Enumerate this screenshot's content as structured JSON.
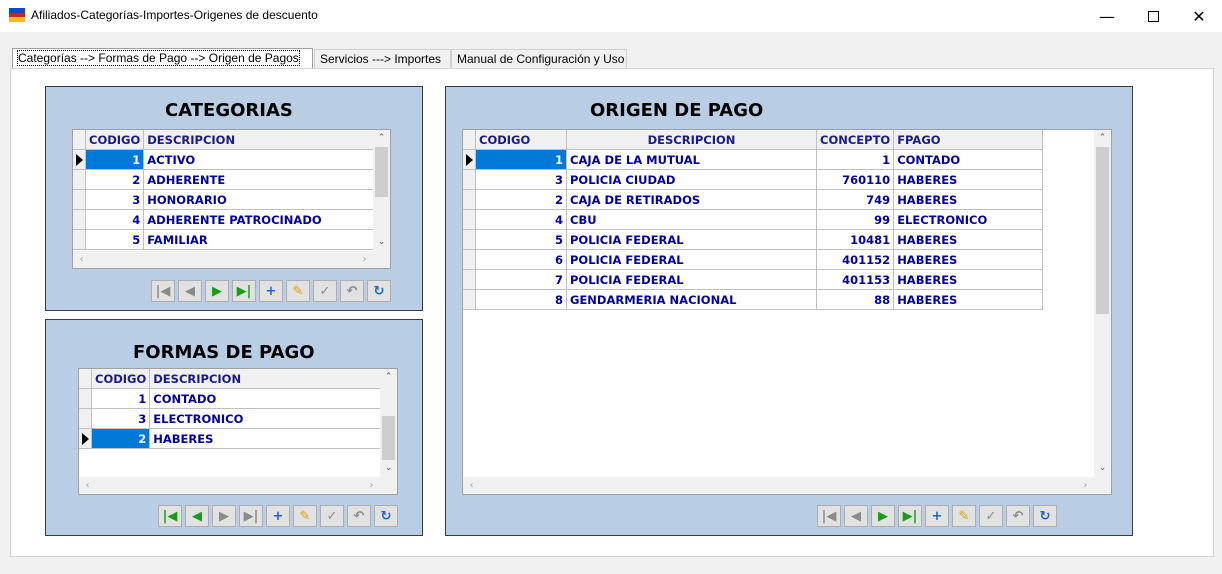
{
  "window": {
    "title": "Afiliados-Categorías-Importes-Origenes de descuento",
    "flag_colors": [
      "#2040c0",
      "#d02020",
      "#f0c000"
    ]
  },
  "tabs": [
    {
      "label": "Categorías  --> Formas de Pago   --> Origen de Pagos",
      "active": true
    },
    {
      "label": "Servicios  ---> Importes",
      "active": false
    },
    {
      "label": "Manual de Configuración y Uso",
      "active": false
    }
  ],
  "categorias": {
    "title": "CATEGORIAS",
    "headers": [
      "CODIGO",
      "DESCRIPCION"
    ],
    "rows": [
      {
        "codigo": "1",
        "descripcion": "ACTIVO"
      },
      {
        "codigo": "2",
        "descripcion": "ADHERENTE"
      },
      {
        "codigo": "3",
        "descripcion": "HONORARIO"
      },
      {
        "codigo": "4",
        "descripcion": "ADHERENTE PATROCINADO"
      },
      {
        "codigo": "5",
        "descripcion": "FAMILIAR"
      }
    ]
  },
  "formas_pago": {
    "title": "FORMAS DE PAGO",
    "headers": [
      "CODIGO",
      "DESCRIPCION"
    ],
    "rows": [
      {
        "codigo": "1",
        "descripcion": "CONTADO"
      },
      {
        "codigo": "3",
        "descripcion": "ELECTRONICO"
      },
      {
        "codigo": "2",
        "descripcion": "HABERES"
      }
    ]
  },
  "origen_pago": {
    "title": "ORIGEN DE PAGO",
    "headers": [
      "CODIGO",
      "DESCRIPCION",
      "CONCEPTO",
      "FPAGO"
    ],
    "rows": [
      {
        "codigo": "1",
        "descripcion": "CAJA DE LA MUTUAL",
        "concepto": "1",
        "fpago": "CONTADO"
      },
      {
        "codigo": "3",
        "descripcion": "POLICIA CIUDAD",
        "concepto": "760110",
        "fpago": "HABERES"
      },
      {
        "codigo": "2",
        "descripcion": "CAJA DE RETIRADOS",
        "concepto": "749",
        "fpago": "HABERES"
      },
      {
        "codigo": "4",
        "descripcion": "CBU",
        "concepto": "99",
        "fpago": "ELECTRONICO"
      },
      {
        "codigo": "5",
        "descripcion": "POLICIA FEDERAL",
        "concepto": "10481",
        "fpago": "HABERES"
      },
      {
        "codigo": "6",
        "descripcion": "POLICIA FEDERAL",
        "concepto": "401152",
        "fpago": "HABERES"
      },
      {
        "codigo": "7",
        "descripcion": "POLICIA FEDERAL",
        "concepto": "401153",
        "fpago": "HABERES"
      },
      {
        "codigo": "8",
        "descripcion": "GENDARMERIA NACIONAL",
        "concepto": "88",
        "fpago": "HABERES"
      }
    ]
  },
  "colors": {
    "panel_bg": "#b9cde5",
    "selected": "#0078d7",
    "grid_text": "#00009c"
  }
}
